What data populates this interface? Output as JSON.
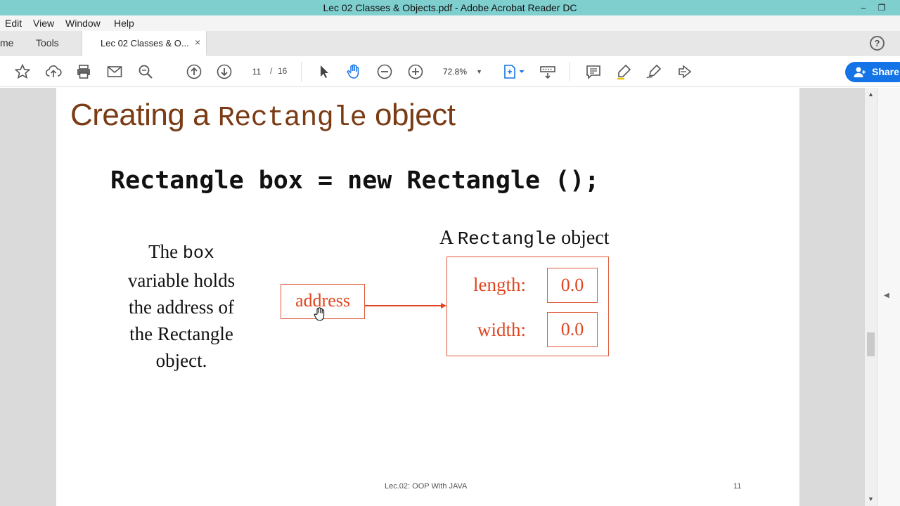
{
  "window": {
    "title": "Lec 02 Classes & Objects.pdf - Adobe Acrobat Reader DC",
    "minimize": "–",
    "restore": "❐"
  },
  "menu": {
    "items": [
      "Edit",
      "View",
      "Window",
      "Help"
    ]
  },
  "tabs": {
    "home": "me",
    "tools": "Tools",
    "document": "Lec 02 Classes & O...",
    "close": "×",
    "help": "?"
  },
  "toolbar": {
    "page_current": "11",
    "page_sep": "/",
    "page_total": "16",
    "zoom": "72.8%",
    "zoom_caret": "▼",
    "share_label": "Share",
    "icons": [
      "star-icon",
      "upload-icon",
      "print-icon",
      "email-icon",
      "search-icon",
      "page-up-icon",
      "page-down-icon",
      "select-pointer-icon",
      "hand-tool-icon",
      "zoom-out-icon",
      "zoom-in-icon",
      "fit-page-icon",
      "scroll-mode-icon",
      "comment-icon",
      "highlight-icon",
      "sign-icon",
      "more-tools-icon"
    ]
  },
  "slide": {
    "title_part1": "Creating a ",
    "title_mono": "Rectangle",
    "title_part2": " object",
    "code": "Rectangle box = new Rectangle ();",
    "caption_part1": "A ",
    "caption_mono": "Rectangle",
    "caption_part2": " object",
    "desc_line1a": "The ",
    "desc_line1b": "box",
    "desc_line2": "variable holds",
    "desc_line3": "the address of",
    "desc_line4": "the Rectangle",
    "desc_line5": "object.",
    "address_label": "address",
    "length_label": "length:",
    "length_value": "0.0",
    "width_label": "width:",
    "width_value": "0.0",
    "footer_text": "Lec.02: OOP With JAVA",
    "footer_page": "11"
  },
  "scrollbar": {
    "up": "▲",
    "down": "▼"
  },
  "right_pane": {
    "toggle": "◀"
  },
  "colors": {
    "titlebar": "#7fcfcf",
    "accent": "#1473e6",
    "slide_title": "#7a3b15",
    "diagram": "#e0451f"
  }
}
